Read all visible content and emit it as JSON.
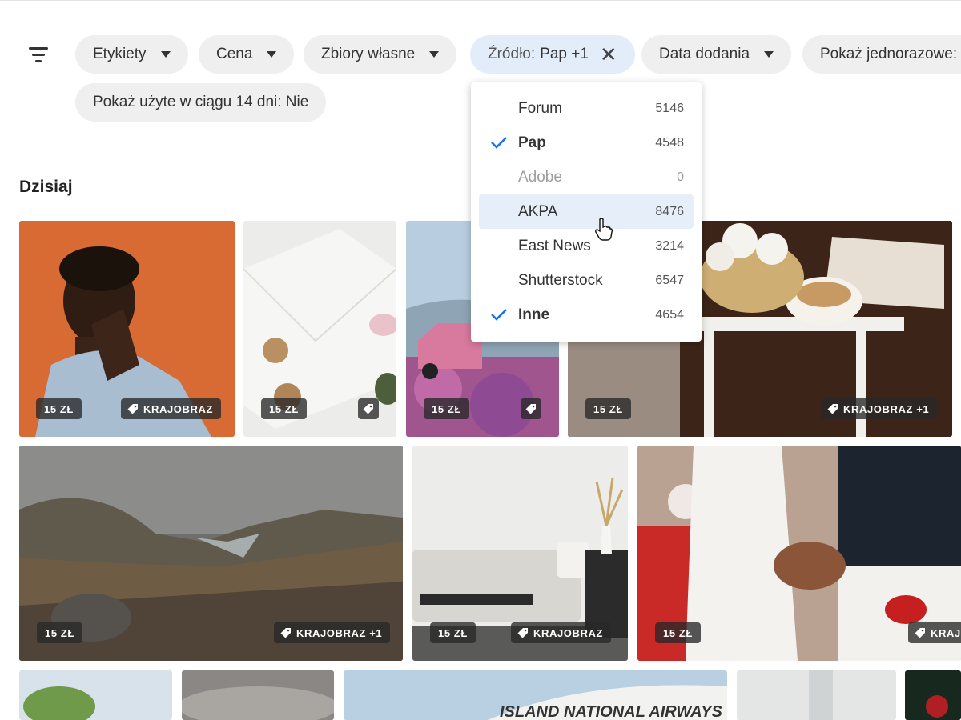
{
  "filters": {
    "chips": [
      {
        "label": "Etykiety"
      },
      {
        "label": "Cena"
      },
      {
        "label": "Zbiory własne"
      },
      {
        "label": "Data dodania"
      },
      {
        "label": "Pokaż jednorazowe:"
      }
    ],
    "active_chip": {
      "label": "Źródło:",
      "value": "Pap +1"
    },
    "second_row_chip": {
      "label": "Pokaż użyte w ciągu 14 dni: Nie"
    }
  },
  "section": {
    "title": "Dzisiaj"
  },
  "source_dropdown": {
    "options": [
      {
        "name": "Forum",
        "count": "5146",
        "checked": false,
        "disabled": false
      },
      {
        "name": "Pap",
        "count": "4548",
        "checked": true,
        "disabled": false
      },
      {
        "name": "Adobe",
        "count": "0",
        "checked": false,
        "disabled": true
      },
      {
        "name": "AKPA",
        "count": "8476",
        "checked": false,
        "disabled": false,
        "hovered": true
      },
      {
        "name": "East News",
        "count": "3214",
        "checked": false,
        "disabled": false
      },
      {
        "name": "Shutterstock",
        "count": "6547",
        "checked": false,
        "disabled": false
      },
      {
        "name": "Inne",
        "count": "4654",
        "checked": true,
        "disabled": false
      }
    ]
  },
  "photos": [
    {
      "price": "15 ZŁ",
      "tag": "KRAJOBRAZ"
    },
    {
      "price": "15 ZŁ",
      "tag": ""
    },
    {
      "price": "15 ZŁ",
      "tag": ""
    },
    {
      "price": "15 ZŁ",
      "tag": "KRAJOBRAZ +1"
    },
    {
      "price": "15 ZŁ",
      "tag": "KRAJOBRAZ +1"
    },
    {
      "price": "15 ZŁ",
      "tag": "KRAJOBRAZ"
    },
    {
      "price": "15 ZŁ",
      "tag": "KRAJ"
    }
  ],
  "partial_tile_text": "ISLAND NATIONAL AIRWAYS CORPORAT",
  "icons": {
    "filter": "filter-lines-icon",
    "caret": "caret-down-icon",
    "clear": "close-icon",
    "tag": "price-tag-icon",
    "check": "check-icon",
    "cursor": "hand-pointer-icon"
  },
  "colors": {
    "accent": "#1a73e8",
    "chip_bg": "#efefef",
    "active_chip_bg": "#e3edfa",
    "hover_row": "#e6eef9"
  }
}
